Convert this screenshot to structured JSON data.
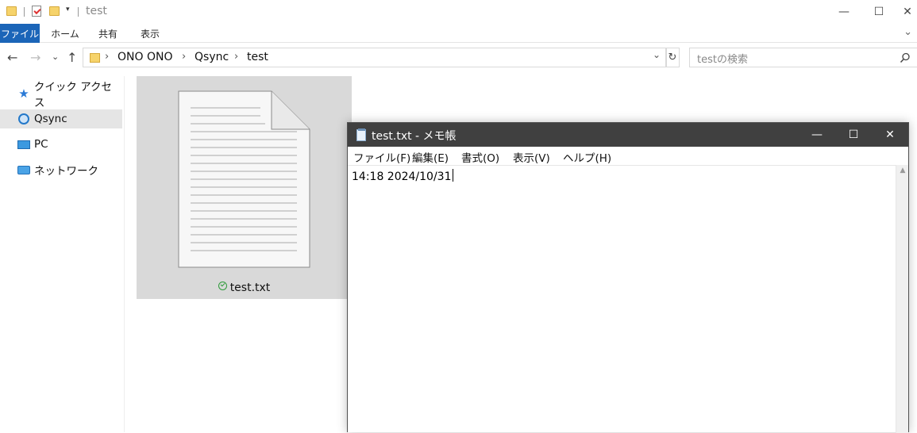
{
  "explorer": {
    "window_title": "test",
    "quick_access": {
      "dropdown_glyph": "▾"
    },
    "window_controls": {
      "minimize": "—",
      "maximize": "☐",
      "close": "✕"
    },
    "ribbon": {
      "tabs": [
        "ファイル",
        "ホーム",
        "共有",
        "表示"
      ],
      "expand_glyph": "⌄",
      "accent": "#1b65b8"
    },
    "nav_buttons": {
      "back": "←",
      "forward": "→",
      "recent": "⌄",
      "up": "↑"
    },
    "address": {
      "breadcrumbs": [
        "ONO ONO",
        "Qsync",
        "test"
      ],
      "separator": "›",
      "chevron": "⌄",
      "refresh": "↻"
    },
    "search": {
      "placeholder": "testの検索",
      "icon": "search-icon"
    },
    "navpane": {
      "items": [
        {
          "label": "クイック アクセス",
          "icon": "pin-star-icon",
          "selected": false
        },
        {
          "label": "Qsync",
          "icon": "qsync-icon",
          "selected": true
        },
        {
          "label": "PC",
          "icon": "pc-icon",
          "selected": false
        },
        {
          "label": "ネットワーク",
          "icon": "network-icon",
          "selected": false
        }
      ]
    },
    "files": [
      {
        "name": "test.txt",
        "status": "synced",
        "selected": true
      }
    ]
  },
  "notepad": {
    "title": "test.txt - メモ帳",
    "window_controls": {
      "minimize": "—",
      "maximize": "☐",
      "close": "✕"
    },
    "menu": [
      "ファイル(F)",
      "編集(E)",
      "書式(O)",
      "表示(V)",
      "ヘルプ(H)"
    ],
    "content": "14:18 2024/10/31",
    "scroll_up_glyph": "▲"
  }
}
